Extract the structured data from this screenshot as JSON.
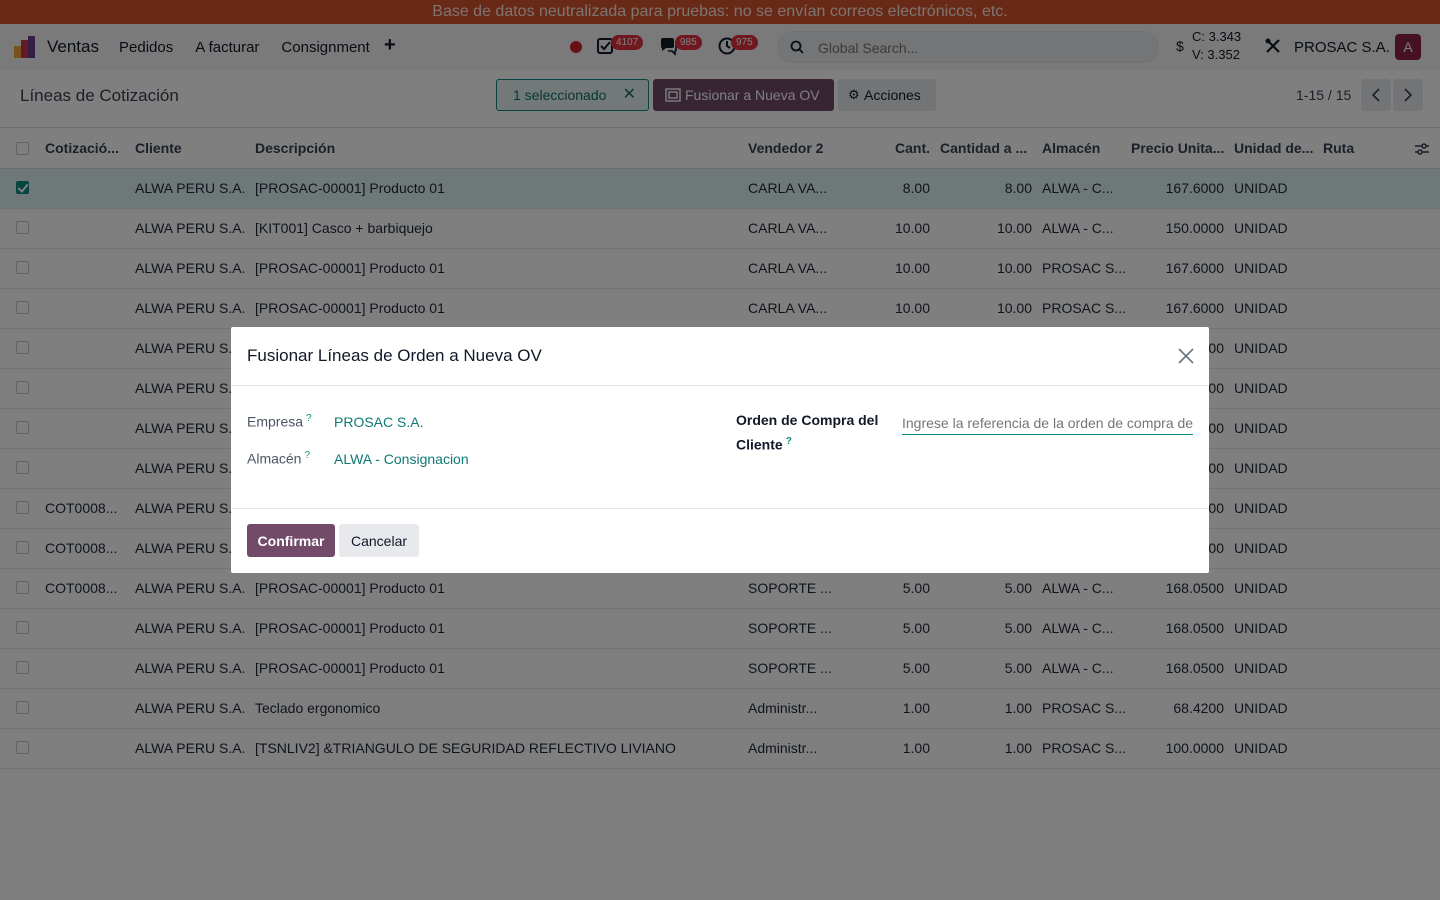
{
  "banner": "Base de datos neutralizada para pruebas: no se envían correos electrónicos, etc.",
  "navbar": {
    "app_name": "Ventas",
    "menu": [
      "Pedidos",
      "A facturar",
      "Consignment"
    ],
    "plus": "+",
    "badges": {
      "activities": "4107",
      "messages": "985",
      "timers": "975"
    },
    "search_placeholder": "Global Search...",
    "currency_symbol": "$",
    "rate_c": "C: 3.343",
    "rate_v": "V: 3.352",
    "company": "PROSAC S.A.",
    "avatar_letter": "A",
    "colors": {
      "avatar": "#8d2346",
      "badge": "#e1313e"
    }
  },
  "control": {
    "title": "Líneas de Cotización",
    "selected": "1 seleccionado",
    "merge_button": "Fusionar a Nueva OV",
    "actions_button": "Acciones",
    "pager": "1-15 / 15"
  },
  "table": {
    "headers": [
      "Cotizació...",
      "Cliente",
      "Descripción",
      "Vendedor 2",
      "Cant.",
      "Cantidad a ...",
      "Almacén",
      "Precio Unita...",
      "Unidad de...",
      "Ruta"
    ],
    "rows": [
      {
        "quote": "",
        "client": "ALWA PERU S.A.",
        "desc": "[PROSAC-00001] Producto 01",
        "seller": "CARLA VA...",
        "qty": "8.00",
        "qty2": "8.00",
        "wh": "ALWA - C...",
        "price": "167.6000",
        "uom": "UNIDAD",
        "selected": true
      },
      {
        "quote": "",
        "client": "ALWA PERU S.A.",
        "desc": "[KIT001] Casco + barbiquejo",
        "seller": "CARLA VA...",
        "qty": "10.00",
        "qty2": "10.00",
        "wh": "ALWA - C...",
        "price": "150.0000",
        "uom": "UNIDAD"
      },
      {
        "quote": "",
        "client": "ALWA PERU S.A.",
        "desc": "[PROSAC-00001] Producto 01",
        "seller": "CARLA VA...",
        "qty": "10.00",
        "qty2": "10.00",
        "wh": "PROSAC S...",
        "price": "167.6000",
        "uom": "UNIDAD"
      },
      {
        "quote": "",
        "client": "ALWA PERU S.A.",
        "desc": "[PROSAC-00001] Producto 01",
        "seller": "CARLA VA...",
        "qty": "10.00",
        "qty2": "10.00",
        "wh": "PROSAC S...",
        "price": "167.6000",
        "uom": "UNIDAD"
      },
      {
        "quote": "",
        "client": "ALWA PERU S.A.",
        "desc": "",
        "seller": "",
        "qty": "",
        "qty2": "",
        "wh": "",
        "price": "00",
        "uom": "UNIDAD"
      },
      {
        "quote": "",
        "client": "ALWA PERU S.A.",
        "desc": "",
        "seller": "",
        "qty": "",
        "qty2": "",
        "wh": "",
        "price": "00",
        "uom": "UNIDAD"
      },
      {
        "quote": "",
        "client": "ALWA PERU S.A.",
        "desc": "",
        "seller": "",
        "qty": "",
        "qty2": "",
        "wh": "",
        "price": "00",
        "uom": "UNIDAD"
      },
      {
        "quote": "",
        "client": "ALWA PERU S.A.",
        "desc": "",
        "seller": "",
        "qty": "",
        "qty2": "",
        "wh": "",
        "price": "00",
        "uom": "UNIDAD"
      },
      {
        "quote": "COT0008...",
        "client": "ALWA PERU S.A.",
        "desc": "",
        "seller": "",
        "qty": "",
        "qty2": "",
        "wh": "",
        "price": "00",
        "uom": "UNIDAD"
      },
      {
        "quote": "COT0008...",
        "client": "ALWA PERU S.A.",
        "desc": "",
        "seller": "",
        "qty": "",
        "qty2": "",
        "wh": "",
        "price": "00",
        "uom": "UNIDAD"
      },
      {
        "quote": "COT0008...",
        "client": "ALWA PERU S.A.",
        "desc": "[PROSAC-00001] Producto 01",
        "seller": "SOPORTE ...",
        "qty": "5.00",
        "qty2": "5.00",
        "wh": "ALWA - C...",
        "price": "168.0500",
        "uom": "UNIDAD"
      },
      {
        "quote": "",
        "client": "ALWA PERU S.A.",
        "desc": "[PROSAC-00001] Producto 01",
        "seller": "SOPORTE ...",
        "qty": "5.00",
        "qty2": "5.00",
        "wh": "ALWA - C...",
        "price": "168.0500",
        "uom": "UNIDAD"
      },
      {
        "quote": "",
        "client": "ALWA PERU S.A.",
        "desc": "[PROSAC-00001] Producto 01",
        "seller": "SOPORTE ...",
        "qty": "5.00",
        "qty2": "5.00",
        "wh": "ALWA - C...",
        "price": "168.0500",
        "uom": "UNIDAD"
      },
      {
        "quote": "",
        "client": "ALWA PERU S.A.",
        "desc": "Teclado ergonomico",
        "seller": "Administr...",
        "qty": "1.00",
        "qty2": "1.00",
        "wh": "PROSAC S...",
        "price": "68.4200",
        "uom": "UNIDAD"
      },
      {
        "quote": "",
        "client": "ALWA PERU S.A.",
        "desc": "[TSNLIV2] &TRIANGULO DE SEGURIDAD REFLECTIVO LIVIANO",
        "seller": "Administr...",
        "qty": "1.00",
        "qty2": "1.00",
        "wh": "PROSAC S...",
        "price": "100.0000",
        "uom": "UNIDAD"
      }
    ]
  },
  "modal": {
    "title": "Fusionar Líneas de Orden a Nueva OV",
    "company_label": "Empresa",
    "company_value": "PROSAC S.A.",
    "warehouse_label": "Almacén",
    "warehouse_value": "ALWA - Consignacion",
    "po_label_1": "Orden de Compra del",
    "po_label_2": "Cliente",
    "help": "?",
    "po_placeholder": "Ingrese la referencia de la orden de compra del cliente",
    "confirm": "Confirmar",
    "cancel": "Cancelar"
  },
  "theme": {
    "primary": "#714b67",
    "accent": "#0f8a82",
    "banner": "#d2522f"
  }
}
